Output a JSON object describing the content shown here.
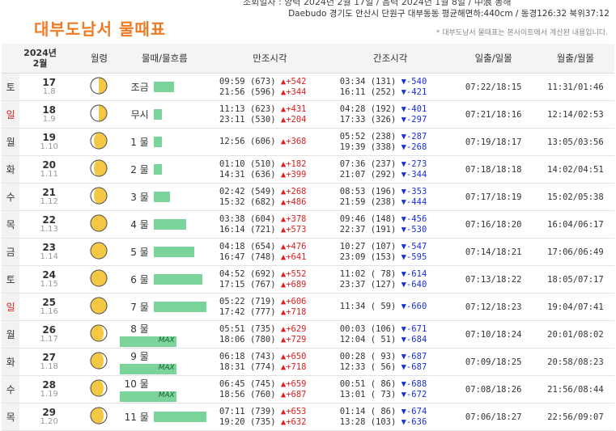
{
  "header": {
    "top_line": "조회일자 : 양력 2024년 2월 17일 / 음력 2024년 1월 8일 / 中浪 동해",
    "location_line": "Daebudo 경기도 안산시 단원구 대부동동 평균해면하:440cm / 동경126:32 북위37:12",
    "title": "대부도남서 물때표",
    "note": "* 대부도남서 물때표는 본사이트에서 계산된 내용입니다."
  },
  "table": {
    "year_label": "2024년",
    "month_label": "2월",
    "columns": [
      "월령",
      "물때/물흐름",
      "만조시각",
      "간조시각",
      "일출/일몰",
      "월출/월몰"
    ],
    "rows": [
      {
        "weekday": "토",
        "red": false,
        "day": "17",
        "lunar": "1.8",
        "moon": "first-quarter",
        "flow": "조금",
        "bar": 0.35,
        "max": "",
        "high": [
          {
            "t": "09:59",
            "h": "(673)",
            "c": "▲+542"
          },
          {
            "t": "21:56",
            "h": "(596)",
            "c": "▲+344"
          }
        ],
        "low": [
          {
            "t": "03:34",
            "h": "(131)",
            "c": "▼-540"
          },
          {
            "t": "16:11",
            "h": "(252)",
            "c": "▼-421"
          }
        ],
        "sun": "07:22/18:15",
        "moonrs": "11:31/01:46"
      },
      {
        "weekday": "일",
        "red": true,
        "day": "18",
        "lunar": "1.9",
        "moon": "first-quarter",
        "flow": "무시",
        "bar": 0.14,
        "max": "",
        "high": [
          {
            "t": "11:13",
            "h": "(623)",
            "c": "▲+431"
          },
          {
            "t": "23:11",
            "h": "(530)",
            "c": "▲+204"
          }
        ],
        "low": [
          {
            "t": "04:28",
            "h": "(192)",
            "c": "▼-401"
          },
          {
            "t": "17:33",
            "h": "(326)",
            "c": "▼-297"
          }
        ],
        "sun": "07:21/18:16",
        "moonrs": "12:14/02:53"
      },
      {
        "weekday": "월",
        "red": false,
        "day": "19",
        "lunar": "1.10",
        "moon": "waxing-gibbous",
        "flow": "1 물",
        "bar": 0.14,
        "max": "",
        "high": [
          {
            "t": "12:56",
            "h": "(606)",
            "c": "▲+368"
          }
        ],
        "low": [
          {
            "t": "05:52",
            "h": "(238)",
            "c": "▼-287"
          },
          {
            "t": "19:39",
            "h": "(338)",
            "c": "▼-268"
          }
        ],
        "sun": "07:19/18:17",
        "moonrs": "13:05/03:56"
      },
      {
        "weekday": "화",
        "red": false,
        "day": "20",
        "lunar": "1.11",
        "moon": "waxing-gibbous",
        "flow": "2 물",
        "bar": 0.14,
        "max": "",
        "high": [
          {
            "t": "01:10",
            "h": "(510)",
            "c": "▲+182"
          },
          {
            "t": "14:31",
            "h": "(636)",
            "c": "▲+399"
          }
        ],
        "low": [
          {
            "t": "07:36",
            "h": "(237)",
            "c": "▼-273"
          },
          {
            "t": "21:07",
            "h": "(292)",
            "c": "▼-344"
          }
        ],
        "sun": "07:18/18:18",
        "moonrs": "14:02/04:51"
      },
      {
        "weekday": "수",
        "red": false,
        "day": "21",
        "lunar": "1.12",
        "moon": "waxing-gibbous",
        "flow": "3 물",
        "bar": 0.29,
        "max": "",
        "high": [
          {
            "t": "02:42",
            "h": "(549)",
            "c": "▲+268"
          },
          {
            "t": "15:32",
            "h": "(682)",
            "c": "▲+486"
          }
        ],
        "low": [
          {
            "t": "08:53",
            "h": "(196)",
            "c": "▼-353"
          },
          {
            "t": "21:59",
            "h": "(238)",
            "c": "▼-444"
          }
        ],
        "sun": "07:17/18:19",
        "moonrs": "15:02/05:38"
      },
      {
        "weekday": "목",
        "red": false,
        "day": "22",
        "lunar": "1.13",
        "moon": "full",
        "flow": "4 물",
        "bar": 0.57,
        "max": "",
        "high": [
          {
            "t": "03:38",
            "h": "(604)",
            "c": "▲+378"
          },
          {
            "t": "16:14",
            "h": "(721)",
            "c": "▲+573"
          }
        ],
        "low": [
          {
            "t": "09:46",
            "h": "(148)",
            "c": "▼-456"
          },
          {
            "t": "22:37",
            "h": "(191)",
            "c": "▼-530"
          }
        ],
        "sun": "07:16/18:20",
        "moonrs": "16:04/06:17"
      },
      {
        "weekday": "금",
        "red": false,
        "day": "23",
        "lunar": "1.14",
        "moon": "full",
        "flow": "5 물",
        "bar": 0.71,
        "max": "",
        "high": [
          {
            "t": "04:18",
            "h": "(654)",
            "c": "▲+476"
          },
          {
            "t": "16:47",
            "h": "(748)",
            "c": "▲+641"
          }
        ],
        "low": [
          {
            "t": "10:27",
            "h": "(107)",
            "c": "▼-547"
          },
          {
            "t": "23:09",
            "h": "(153)",
            "c": "▼-595"
          }
        ],
        "sun": "07:14/18:21",
        "moonrs": "17:06/06:49"
      },
      {
        "weekday": "토",
        "red": false,
        "day": "24",
        "lunar": "1.15",
        "moon": "full",
        "flow": "6 물",
        "bar": 0.86,
        "max": "",
        "high": [
          {
            "t": "04:52",
            "h": "(692)",
            "c": "▲+552"
          },
          {
            "t": "17:15",
            "h": "(767)",
            "c": "▲+689"
          }
        ],
        "low": [
          {
            "t": "11:02",
            "h": "( 78)",
            "c": "▼-614"
          },
          {
            "t": "23:37",
            "h": "(127)",
            "c": "▼-640"
          }
        ],
        "sun": "07:13/18:22",
        "moonrs": "18:05/07:17"
      },
      {
        "weekday": "일",
        "red": true,
        "day": "25",
        "lunar": "1.16",
        "moon": "full",
        "flow": "7 물",
        "bar": 0.93,
        "max": "",
        "high": [
          {
            "t": "05:22",
            "h": "(719)",
            "c": "▲+606"
          },
          {
            "t": "17:42",
            "h": "(777)",
            "c": "▲+718"
          }
        ],
        "low": [
          {
            "t": "11:34",
            "h": "( 59)",
            "c": "▼-660"
          }
        ],
        "sun": "07:12/18:23",
        "moonrs": "19:04/07:41"
      },
      {
        "weekday": "월",
        "red": false,
        "day": "26",
        "lunar": "1.17",
        "moon": "waning-gibbous",
        "flow": "8 물",
        "bar": 1.0,
        "max": "MAX",
        "high": [
          {
            "t": "05:51",
            "h": "(735)",
            "c": "▲+629"
          },
          {
            "t": "18:06",
            "h": "(780)",
            "c": "▲+729"
          }
        ],
        "low": [
          {
            "t": "00:03",
            "h": "(106)",
            "c": "▼-671"
          },
          {
            "t": "12:04",
            "h": "( 51)",
            "c": "▼-684"
          }
        ],
        "sun": "07:10/18:24",
        "moonrs": "20:01/08:02"
      },
      {
        "weekday": "화",
        "red": false,
        "day": "27",
        "lunar": "1.18",
        "moon": "waning-gibbous",
        "flow": "9 물",
        "bar": 1.0,
        "max": "MAX",
        "high": [
          {
            "t": "06:18",
            "h": "(743)",
            "c": "▲+650"
          },
          {
            "t": "18:31",
            "h": "(774)",
            "c": "▲+718"
          }
        ],
        "low": [
          {
            "t": "00:28",
            "h": "( 93)",
            "c": "▼-687"
          },
          {
            "t": "12:33",
            "h": "( 56)",
            "c": "▼-687"
          }
        ],
        "sun": "07:09/18:25",
        "moonrs": "20:58/08:23"
      },
      {
        "weekday": "수",
        "red": false,
        "day": "28",
        "lunar": "1.19",
        "moon": "waning-gibbous",
        "flow": "10 물",
        "bar": 1.0,
        "max": "MAX",
        "high": [
          {
            "t": "06:45",
            "h": "(745)",
            "c": "▲+659"
          },
          {
            "t": "18:56",
            "h": "(760)",
            "c": "▲+687"
          }
        ],
        "low": [
          {
            "t": "00:51",
            "h": "( 86)",
            "c": "▼-688"
          },
          {
            "t": "13:01",
            "h": "( 73)",
            "c": "▼-672"
          }
        ],
        "sun": "07:08/18:26",
        "moonrs": "21:56/08:44"
      },
      {
        "weekday": "목",
        "red": false,
        "day": "29",
        "lunar": "1.20",
        "moon": "waning-gibbous",
        "flow": "11 물",
        "bar": 0.93,
        "max": "",
        "high": [
          {
            "t": "07:11",
            "h": "(739)",
            "c": "▲+653"
          },
          {
            "t": "19:20",
            "h": "(735)",
            "c": "▲+632"
          }
        ],
        "low": [
          {
            "t": "01:14",
            "h": "( 86)",
            "c": "▼-674"
          },
          {
            "t": "13:28",
            "h": "(103)",
            "c": "▼-636"
          }
        ],
        "sun": "07:06/18:27",
        "moonrs": "22:56/09:07"
      }
    ]
  },
  "colors": {
    "accent": "#ee7a24",
    "bar": "#7bd49a",
    "rise": "#e02020",
    "fall": "#1a2fd8",
    "moon": "#f4c842"
  }
}
